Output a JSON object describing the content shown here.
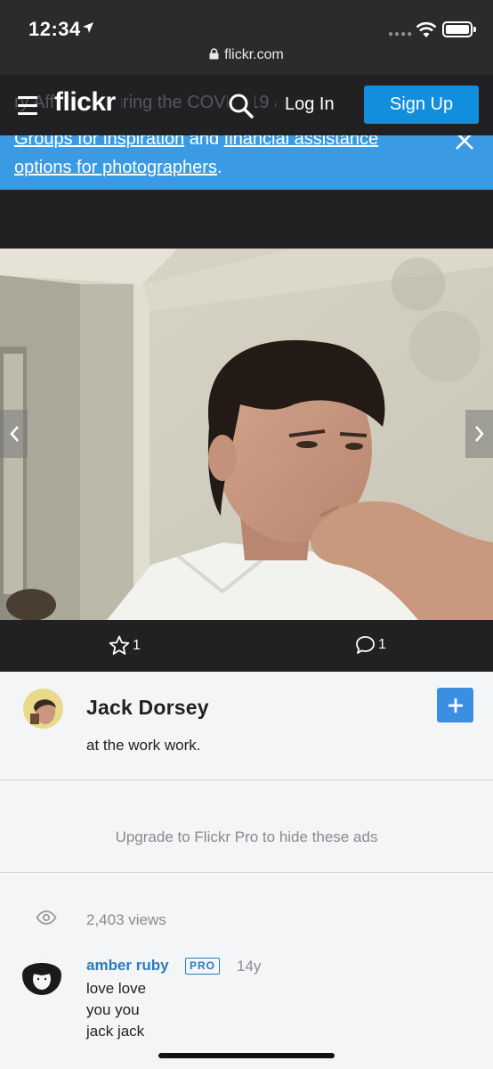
{
  "status_bar": {
    "time": "12:34",
    "url": "flickr.com"
  },
  "header": {
    "logo": "flickr",
    "behind_text": "ry Affected during the COVID-19 and",
    "login_label": "Log In",
    "signup_label": "Sign Up"
  },
  "notice": {
    "link1": "Groups for inspiration",
    "middle": " and ",
    "link2": "financial assistance options for photographers",
    "end": "."
  },
  "engagement": {
    "favorites": "1",
    "comments": "1"
  },
  "owner": {
    "name": "Jack Dorsey",
    "caption": "at the work work."
  },
  "ad": {
    "text": "Upgrade to Flickr Pro to hide these ads"
  },
  "stats": {
    "views": "2,403 views"
  },
  "comment": {
    "author": "amber ruby",
    "badge": "PRO",
    "age": "14y",
    "lines": [
      "love love",
      "you you",
      "jack jack"
    ]
  },
  "colors": {
    "brand_blue": "#128fdc",
    "banner_blue": "#3b9ae4",
    "dark": "#212124",
    "link": "#2b7bbd"
  }
}
